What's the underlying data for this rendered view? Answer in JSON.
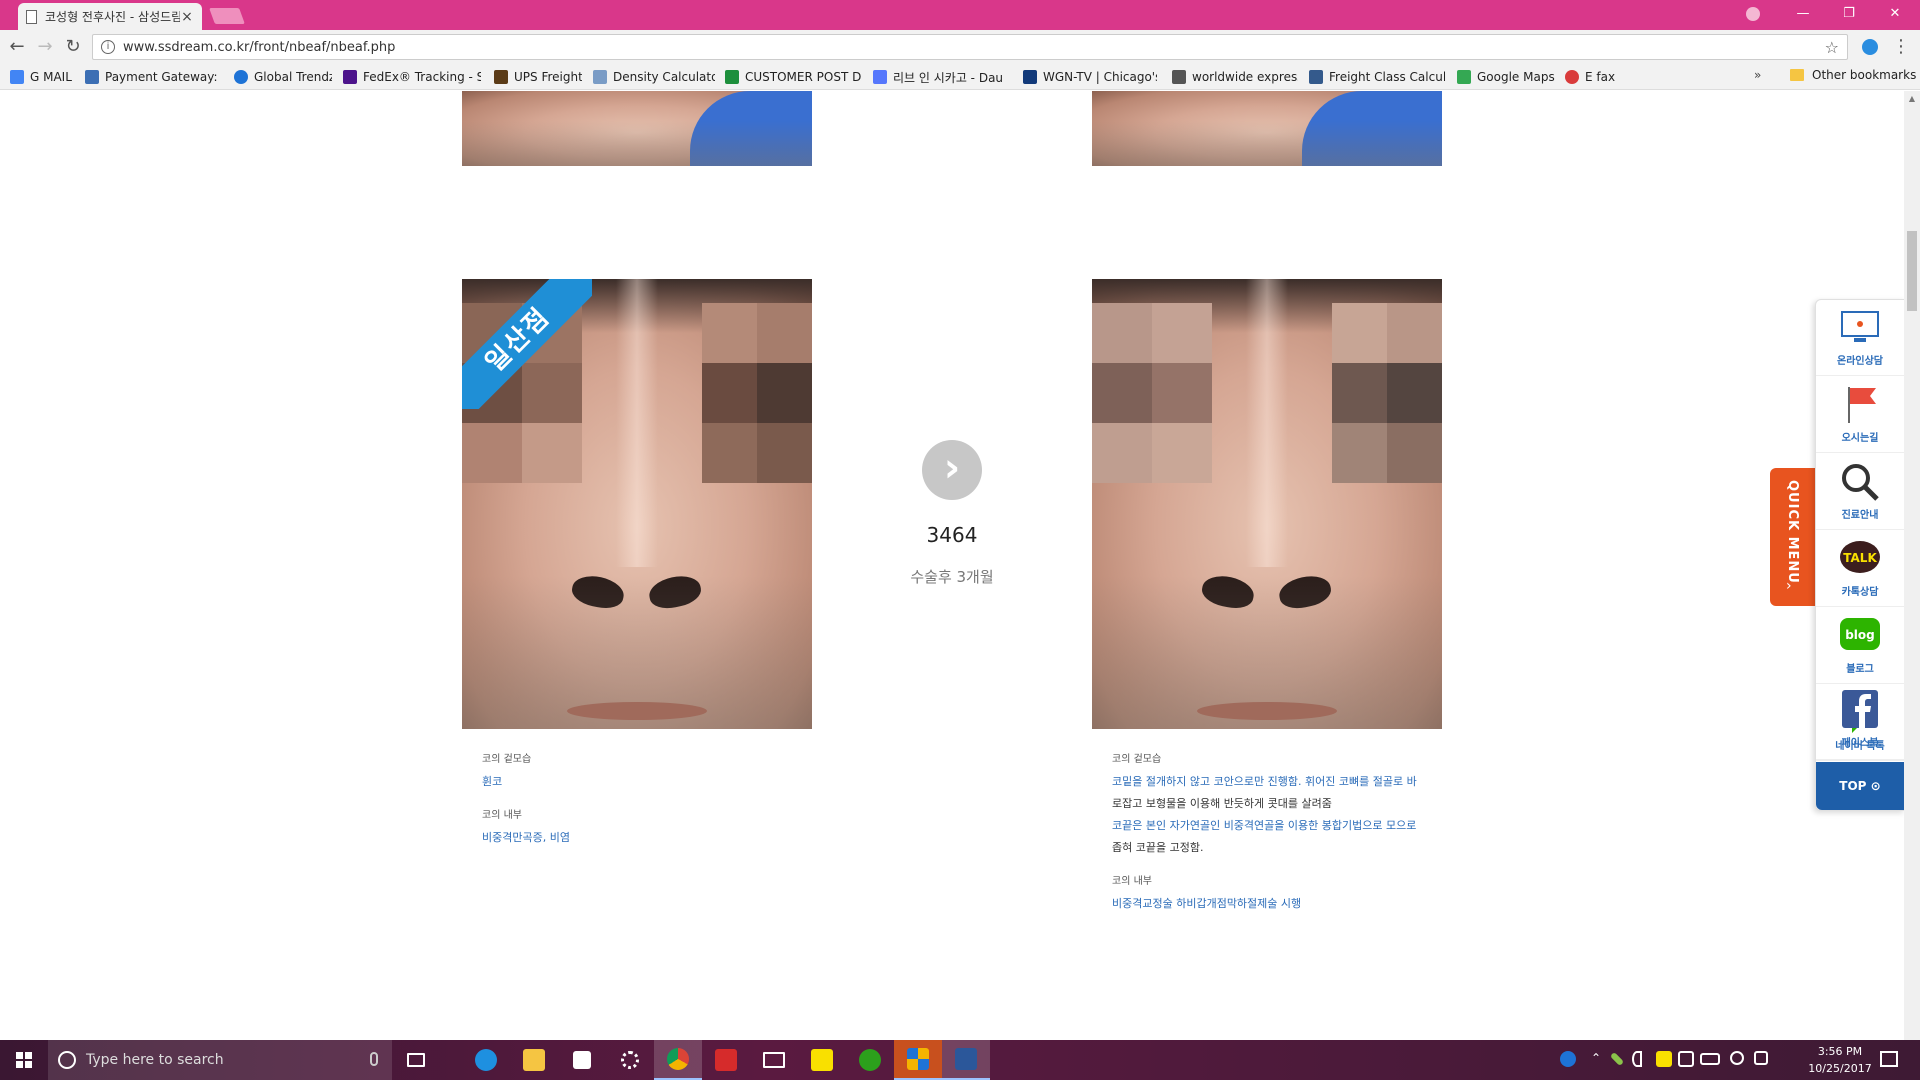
{
  "browser": {
    "tab_title": "코성형 전후사진 - 삼성드림",
    "tab_close": "×",
    "url": "www.ssdream.co.kr/front/nbeaf/nbeaf.php",
    "bookmarks": [
      {
        "label": "G MAIL",
        "color": "#4285f4"
      },
      {
        "label": "Payment Gateway: Ac",
        "color": "#3c6fb4"
      },
      {
        "label": "Global Trendz",
        "color": "#1e73d6"
      },
      {
        "label": "FedEx® Tracking - Sh",
        "color": "#4d148c"
      },
      {
        "label": "UPS Freight",
        "color": "#5b3b17"
      },
      {
        "label": "Density Calculator",
        "color": "#7a9cc6"
      },
      {
        "label": "CUSTOMER POST DA",
        "color": "#1d8f3c"
      },
      {
        "label": "리브 인 시카고 - Dau",
        "color": "#5677fc"
      },
      {
        "label": "WGN-TV | Chicago's",
        "color": "#123a7a"
      },
      {
        "label": "worldwide express",
        "color": "#555555"
      },
      {
        "label": "Freight Class Calculat",
        "color": "#345a8c"
      },
      {
        "label": "Google Maps",
        "color": "#34a853"
      },
      {
        "label": "E fax",
        "color": "#d93b3b"
      }
    ],
    "bookmarks_more": "»",
    "other_bookmarks": "Other bookmarks"
  },
  "colors": {
    "titlebar": "#d9378a",
    "accent_blue": "#2a6bb8",
    "quick_tab": "#e8541f",
    "top_button": "#1e5ea8"
  },
  "gallery": {
    "ribbon_label": "일산점",
    "case_number": "3464",
    "period": "수술후 3개월",
    "before": {
      "label1": "코의 겉모습",
      "value1": "휜코",
      "label2": "코의 내부",
      "value2": "비중격만곡증, 비염"
    },
    "after": {
      "label1": "코의 겉모습",
      "value1_line1": "코밑을 절개하지 않고 코안으로만 진행함. 휘어진 코뼈를 절골로 바",
      "value1_line2": "로잡고 보형물을 이용해 반듯하게 콧대를 살려줌",
      "value1_line3": "코끝은 본인 자가연골인 비중격연골을 이용한 봉합기법으로 모으로",
      "value1_line4": "좁혀 코끝을 고정함.",
      "label2": "코의 내부",
      "value2": "비중격교정술 하비갑개점막하절제술 시행"
    }
  },
  "quick_menu": {
    "tab_label": "QUICK MENU",
    "tab_arrow": "›",
    "items": [
      {
        "label": "온라인상담",
        "icon": "monitor-icon"
      },
      {
        "label": "오시는길",
        "icon": "flag-icon"
      },
      {
        "label": "진료안내",
        "icon": "magnifier-icon"
      },
      {
        "label": "카톡상담",
        "icon": "kakao-talk-icon"
      },
      {
        "label": "블로그",
        "icon": "blog-icon"
      },
      {
        "label": "네이버 톡톡",
        "icon": "naver-talk-icon"
      },
      {
        "label": "페이스북",
        "icon": "facebook-icon"
      }
    ],
    "top_label": "TOP ⊙"
  },
  "taskbar": {
    "search_placeholder": "Type here to search",
    "time": "3:56 PM",
    "date": "10/25/2017"
  }
}
